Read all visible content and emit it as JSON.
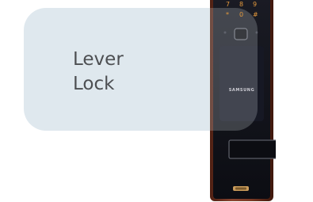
{
  "label": {
    "line1": "Lever",
    "line2": "Lock"
  },
  "lock": {
    "brand": "SAMSUNG",
    "keypad_digits": [
      "7",
      "8",
      "9",
      "*",
      "0",
      "#"
    ]
  },
  "colors": {
    "card": "#dfe8ee",
    "text": "#4d4f52",
    "frame": "#7a3a25",
    "body": "#11121a",
    "keypad_glow": "#e69a3d"
  }
}
